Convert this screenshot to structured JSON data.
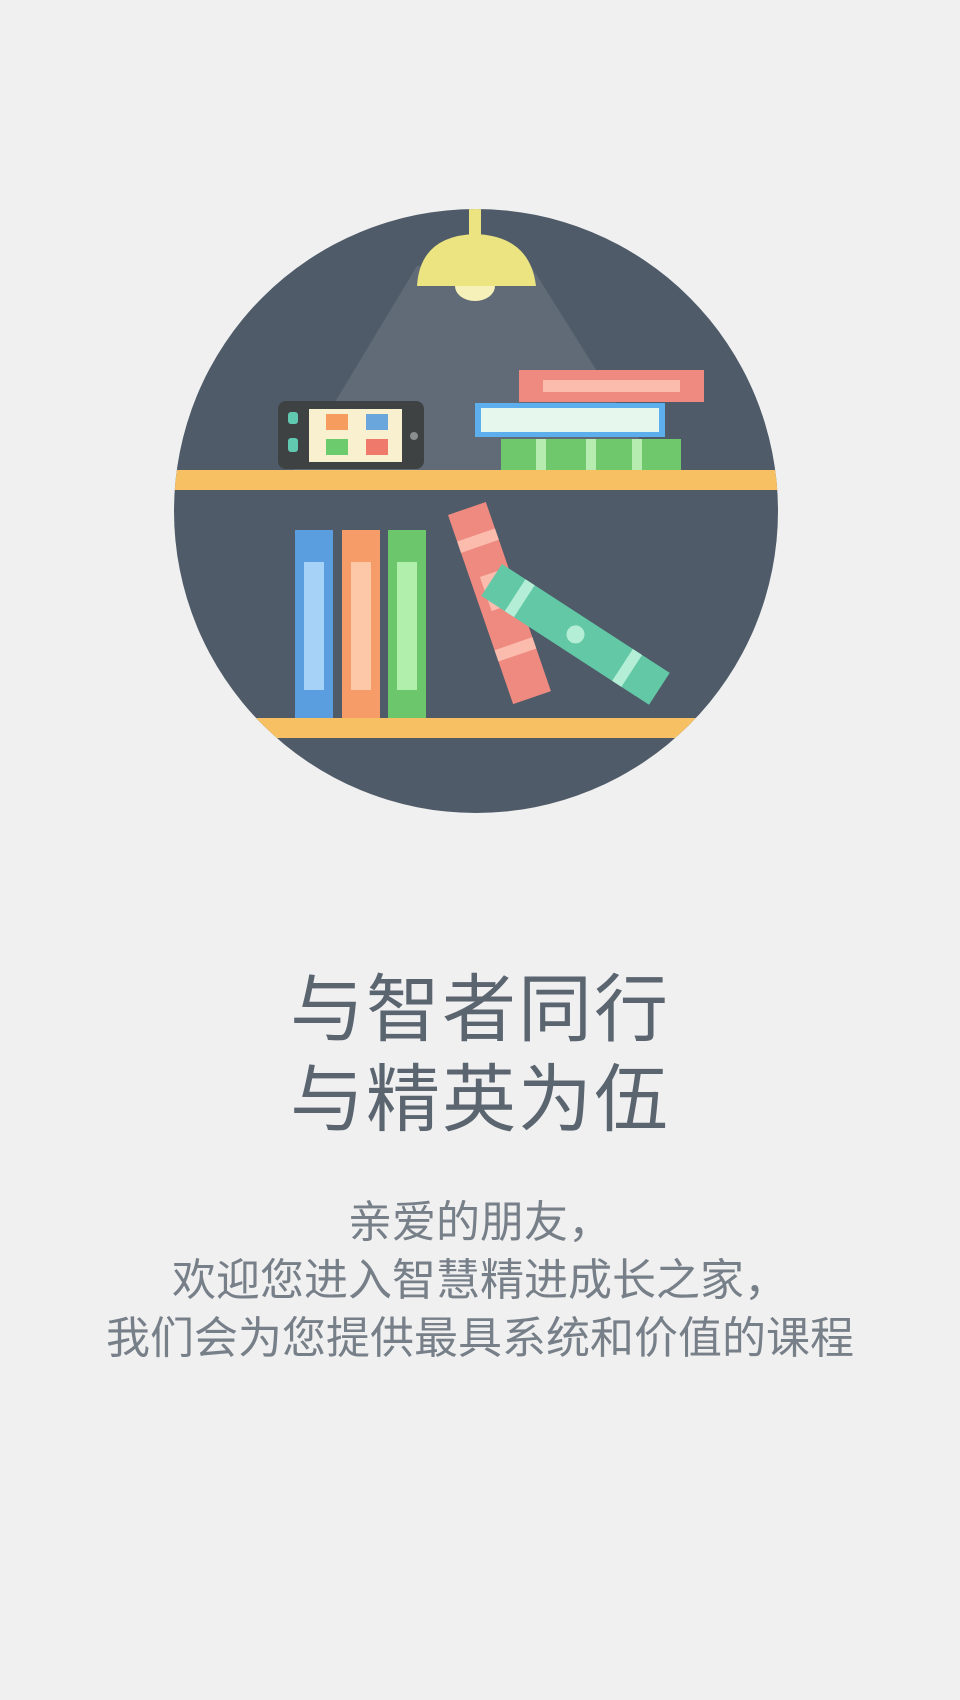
{
  "headline": {
    "line1": "与智者同行",
    "line2": "与精英为伍"
  },
  "description": {
    "line1": "亲爱的朋友，",
    "line2": "欢迎您进入智慧精进成长之家，",
    "line3": "我们会为您提供最具系统和价值的课程"
  },
  "colors": {
    "background": "#f0f0f1",
    "circle": "#4f5b68",
    "shelf": "#f6c063",
    "lamp": "#ebe480",
    "headline_text": "#5b6570",
    "body_text": "#777f88"
  },
  "illustration": {
    "icon": "bookshelf-lamp-illustration"
  }
}
